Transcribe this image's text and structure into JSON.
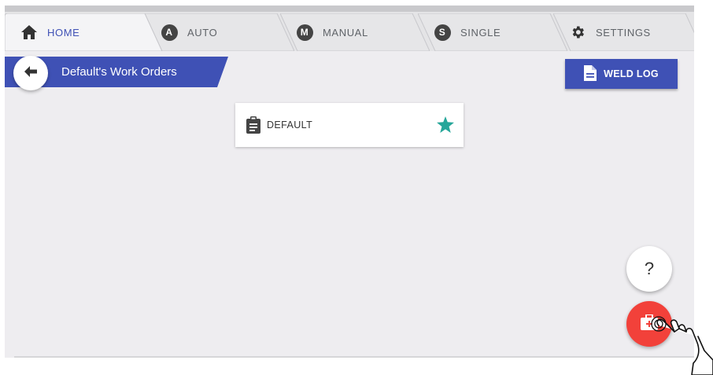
{
  "tabs": [
    {
      "label": "HOME",
      "icon": "home-icon",
      "active": true
    },
    {
      "label": "AUTO",
      "icon": "auto-icon",
      "badge": "A"
    },
    {
      "label": "MANUAL",
      "icon": "manual-icon",
      "badge": "M"
    },
    {
      "label": "SINGLE",
      "icon": "single-icon",
      "badge": "S"
    },
    {
      "label": "SETTINGS",
      "icon": "gear-icon"
    }
  ],
  "header": {
    "title": "Default's Work Orders",
    "weld_log_label": "WELD LOG"
  },
  "work_orders": [
    {
      "label": "DEFAULT",
      "favorite": true
    }
  ],
  "fab": {
    "help_label": "?"
  },
  "colors": {
    "primary": "#3f51b5",
    "star": "#26a69a",
    "fab_red": "#f2413a",
    "background": "#eeedf0"
  }
}
